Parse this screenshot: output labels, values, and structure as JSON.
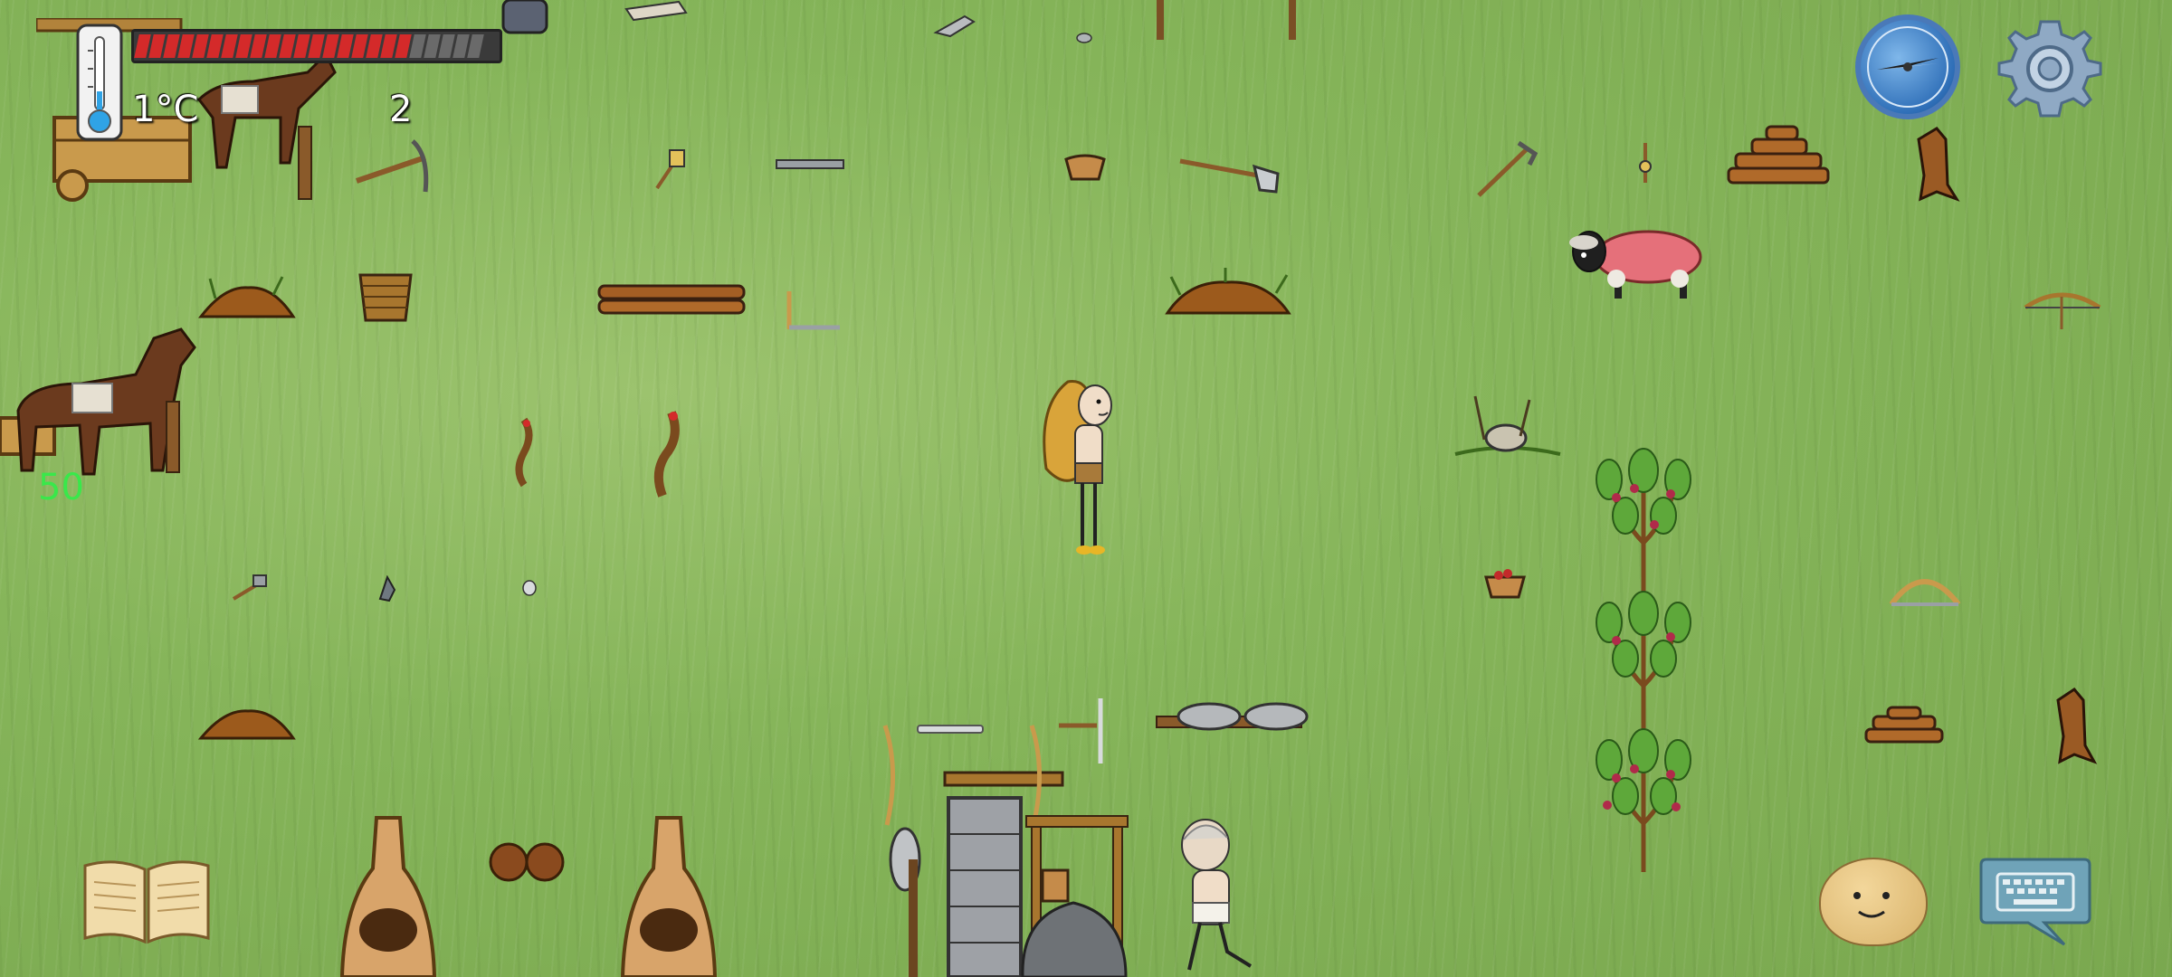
{
  "hud": {
    "temperature": "1°C",
    "age": "2",
    "yum_bonus": "50",
    "food_bar": {
      "filled": 19,
      "total": 24
    }
  },
  "icons": {
    "thermometer": "thermometer-icon",
    "compass": "compass-icon",
    "settings": "gear-icon",
    "tech_book": "book-icon",
    "emote": "emote-face-icon",
    "keyboard": "keyboard-chat-icon"
  },
  "colors": {
    "food_filled": "#d42a2a",
    "food_empty": "#6a6a6a",
    "yum_text": "#39e84a"
  }
}
